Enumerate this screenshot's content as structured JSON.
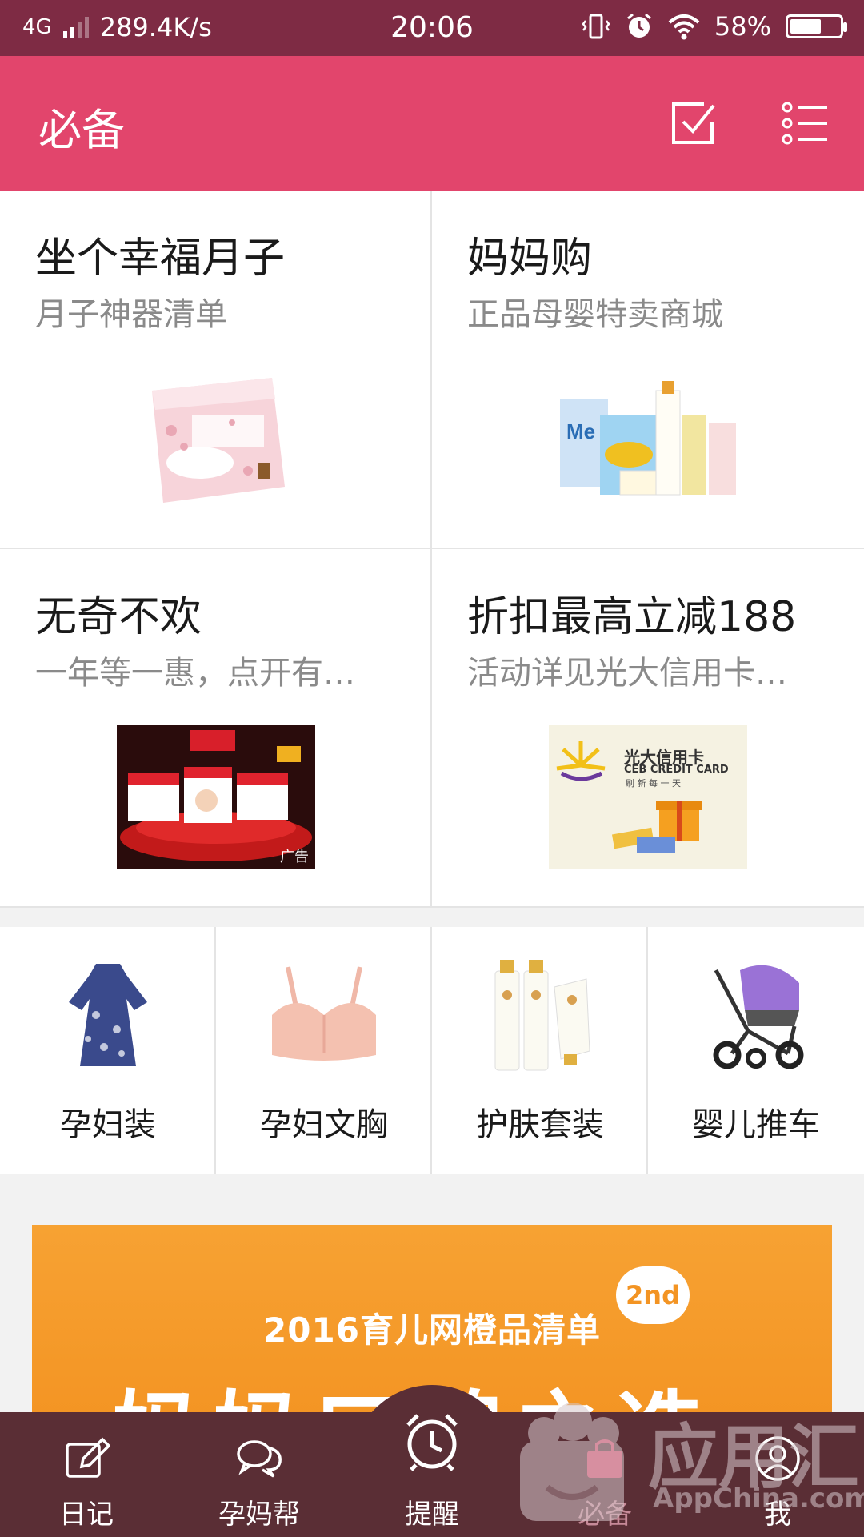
{
  "status_bar": {
    "network": "4G",
    "speed": "289.4K/s",
    "time": "20:06",
    "battery": "58%",
    "battery_level": 0.58
  },
  "app_bar": {
    "title": "必备",
    "check_icon": "checkbox-icon",
    "list_icon": "list-icon"
  },
  "cards": [
    {
      "title": "坐个幸福月子",
      "subtitle": "月子神器清单",
      "image": "maternity-pad-pack"
    },
    {
      "title": "妈妈购",
      "subtitle": "正品母婴特卖商城",
      "image": "baby-products-bundle"
    },
    {
      "title": "无奇不欢",
      "subtitle": "一年等一惠，点开有…",
      "image": "huggies-promo",
      "ad_label": "广告"
    },
    {
      "title": "折扣最高立减188",
      "subtitle": "活动详见光大信用卡…",
      "image": "ceb-credit-card",
      "card_brand": "光大信用卡",
      "card_brand_en": "CEB CREDIT CARD",
      "card_slogan": "刷 新 每 一 天"
    }
  ],
  "categories": [
    {
      "label": "孕妇装",
      "image": "maternity-dress"
    },
    {
      "label": "孕妇文胸",
      "image": "maternity-bra"
    },
    {
      "label": "护肤套装",
      "image": "skincare-set"
    },
    {
      "label": "婴儿推车",
      "image": "baby-stroller"
    }
  ],
  "banner": {
    "headline": "2016育儿网橙品清单",
    "badge": "2nd",
    "big_text": "妈妈口碑之选"
  },
  "bottom_nav": [
    {
      "label": "日记",
      "icon": "pencil-icon"
    },
    {
      "label": "孕妈帮",
      "icon": "chat-bubbles-icon"
    },
    {
      "label": "提醒",
      "icon": "alarm-clock-icon"
    },
    {
      "label": "必备",
      "icon": "bag-icon"
    },
    {
      "label": "我",
      "icon": "user-icon"
    }
  ],
  "watermark": {
    "text": "应用汇",
    "text_en": "AppChina.com"
  },
  "colors": {
    "status_bar": "#7e2b44",
    "app_bar": "#e2456c",
    "bottom_nav": "#5a2e35",
    "banner": "#f39423"
  }
}
